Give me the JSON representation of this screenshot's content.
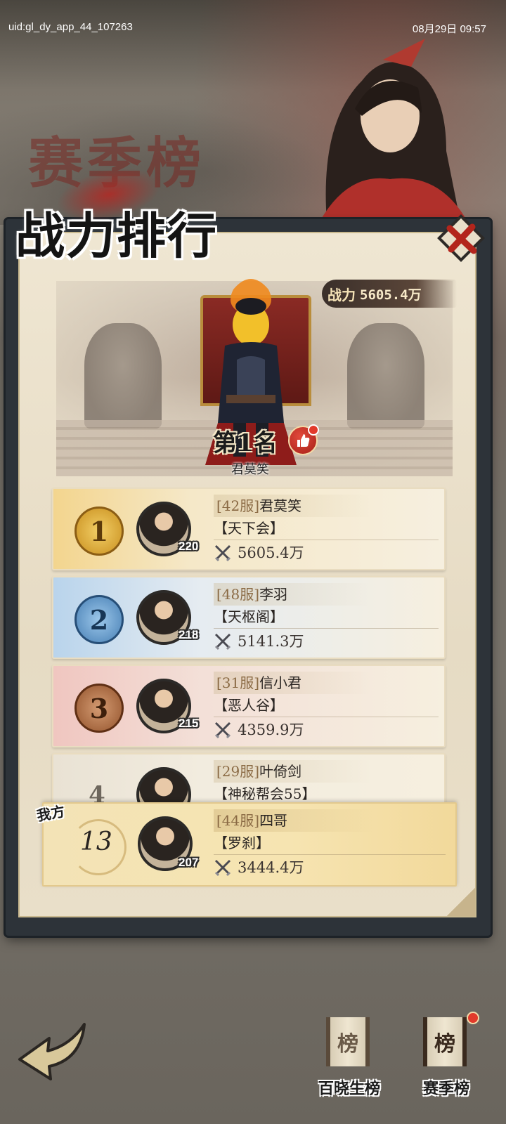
{
  "status_bar": {
    "uid": "uid:gl_dy_app_44_107263",
    "time": "08月29日 09:57"
  },
  "season_banner": "赛季榜",
  "title": "战力排行",
  "top_power": {
    "label": "战力",
    "value": "5605.4万"
  },
  "champion": {
    "rank_tag": "第1名",
    "name": "君莫笑"
  },
  "rankings": [
    {
      "rank": "1",
      "server": "[42服]",
      "name": "君莫笑",
      "guild": "【天下会】",
      "power": "5605.4万",
      "level": "220"
    },
    {
      "rank": "2",
      "server": "[48服]",
      "name": "李羽",
      "guild": "【天枢阁】",
      "power": "5141.3万",
      "level": "218"
    },
    {
      "rank": "3",
      "server": "[31服]",
      "name": "信小君",
      "guild": "【恶人谷】",
      "power": "4359.9万",
      "level": "215"
    },
    {
      "rank": "4",
      "server": "[29服]",
      "name": "叶倚剑",
      "guild": "【神秘帮会55】",
      "power": "",
      "level": ""
    }
  ],
  "my_rank": {
    "tag": "我方",
    "rank": "13",
    "server": "[44服]",
    "name": "四哥",
    "guild": "【罗刹】",
    "power": "3444.4万",
    "level": "207"
  },
  "bottom_tabs": [
    {
      "glyph": "榜",
      "label": "百晓生榜"
    },
    {
      "glyph": "榜",
      "label": "赛季榜"
    }
  ],
  "colors": {
    "accent_red": "#a61f17",
    "gold": "#c98f1e",
    "silver_blue": "#477fb4",
    "bronze": "#93532c"
  }
}
